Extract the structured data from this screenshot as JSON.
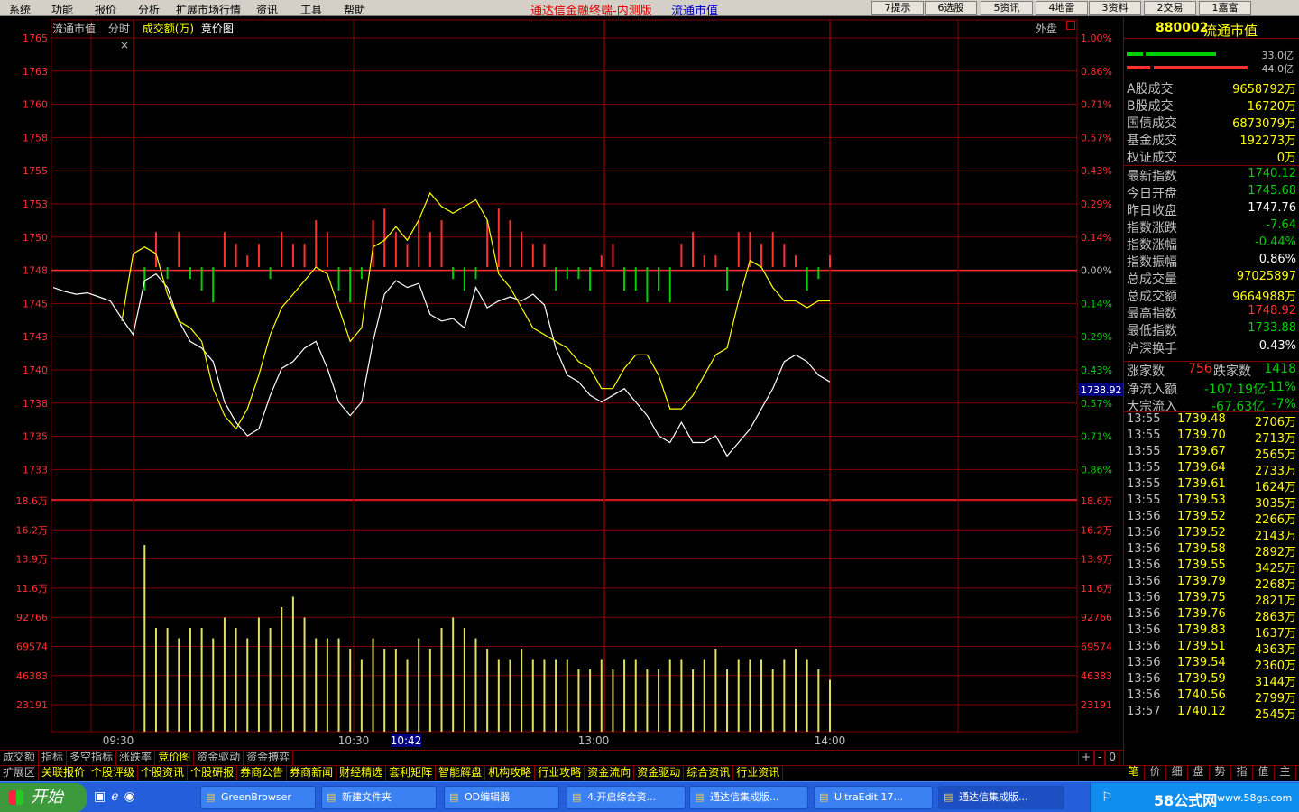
{
  "menu": [
    "系统",
    "功能",
    "报价",
    "分析",
    "扩展市场行情",
    "资讯",
    "工具",
    "帮助"
  ],
  "app_title": "通达信金融终端-内测版",
  "app_subtitle": "流通市值",
  "toolbar_buttons": [
    "7提示",
    "6选股",
    "5资讯",
    "4地雷",
    "3资料",
    "2交易",
    "1嘉富"
  ],
  "chart_header": {
    "name": "流通市值",
    "mode": "分时",
    "indicator": "成交额(万)",
    "extra": "竞价图",
    "outer": "外盘"
  },
  "colors": {
    "up": "#ff3030",
    "down": "#00d000",
    "price": "#ffffff",
    "avg": "#ffff00",
    "grid": "#800000",
    "volume": "#e0e060"
  },
  "chart_data": {
    "type": "line",
    "y_left_price": [
      "1765",
      "1763",
      "1760",
      "1758",
      "1755",
      "1753",
      "1750",
      "1748",
      "1745",
      "1743",
      "1740",
      "1738",
      "1735",
      "1733"
    ],
    "y_right_pct": [
      "1.00%",
      "0.86%",
      "0.71%",
      "0.57%",
      "0.43%",
      "0.29%",
      "0.14%",
      "0.00%",
      "0.14%",
      "0.29%",
      "0.43%",
      "0.57%",
      "0.71%",
      "0.86%"
    ],
    "y_left_volume": [
      "18.6万",
      "16.2万",
      "13.9万",
      "11.6万",
      "92766",
      "69574",
      "46383",
      "23191"
    ],
    "x_ticks": [
      "09:30",
      "10:30",
      "13:00",
      "14:00"
    ],
    "x_cursor": "10:42",
    "price_cursor": "1738.92",
    "price_range": [
      1732,
      1766
    ],
    "price_series": [
      1746.5,
      1746.2,
      1746.0,
      1746.1,
      1745.8,
      1745.5,
      1744.2,
      1743.0,
      1747.0,
      1747.5,
      1746.5,
      1744.0,
      1742.5,
      1742.0,
      1741.0,
      1738.0,
      1736.5,
      1735.5,
      1736.0,
      1738.5,
      1740.5,
      1741.0,
      1742.0,
      1742.5,
      1740.5,
      1738.0,
      1737.0,
      1738.0,
      1742.5,
      1746.0,
      1747.0,
      1746.5,
      1746.8,
      1744.5,
      1744.0,
      1744.2,
      1743.5,
      1746.5,
      1745.0,
      1745.5,
      1745.8,
      1745.5,
      1746.0,
      1745.2,
      1742.0,
      1740.0,
      1739.5,
      1738.5,
      1738.0,
      1738.5,
      1739.0,
      1738.0,
      1737.0,
      1735.5,
      1735.0,
      1736.5,
      1735.0,
      1735.0,
      1735.5,
      1734.0,
      1735.0,
      1736.0,
      1737.5,
      1739.0,
      1741.0,
      1741.5,
      1741.0,
      1740.0,
      1739.5
    ],
    "avg_series": [
      null,
      null,
      null,
      null,
      null,
      null,
      1744.0,
      1749.0,
      1749.5,
      1749.0,
      1746.0,
      1744.0,
      1743.5,
      1742.5,
      1739.0,
      1737.0,
      1736.0,
      1737.5,
      1740.0,
      1743.0,
      1745.0,
      1746.0,
      1747.0,
      1748.0,
      1747.5,
      1745.0,
      1742.5,
      1743.5,
      1749.5,
      1750.0,
      1751.0,
      1750.0,
      1751.5,
      1753.5,
      1752.5,
      1752.0,
      1752.5,
      1753.0,
      1751.5,
      1747.5,
      1746.5,
      1745.0,
      1743.5,
      1743.0,
      1742.5,
      1742.0,
      1741.0,
      1740.5,
      1739.0,
      1739.0,
      1740.5,
      1741.5,
      1741.5,
      1740.0,
      1737.5,
      1737.5,
      1738.5,
      1740.0,
      1741.5,
      1742.0,
      1745.5,
      1748.5,
      1748.0,
      1746.5,
      1745.5,
      1745.5,
      1745.0,
      1745.5,
      1745.5
    ],
    "change_bars": [
      0,
      0,
      0,
      0,
      0,
      0,
      0,
      0,
      -2,
      3,
      -1,
      3,
      -1,
      -2,
      -3,
      3,
      2,
      1,
      2,
      -1,
      3,
      2,
      2,
      4,
      3,
      -2,
      -3,
      -1,
      4,
      5,
      3,
      2,
      4,
      3,
      4,
      -1,
      -2,
      -1,
      4,
      5,
      4,
      3,
      2,
      2,
      -2,
      -1,
      -1,
      -2,
      1,
      2,
      -2,
      -2,
      -3,
      -2,
      -3,
      2,
      3,
      1,
      1,
      -2,
      3,
      3,
      2,
      3,
      2,
      1,
      -2,
      -1,
      1
    ],
    "volume": [
      0,
      0,
      0,
      0,
      0,
      0,
      0,
      0,
      18,
      10,
      10,
      9,
      10,
      10,
      9,
      11,
      10,
      9,
      11,
      10,
      12,
      13,
      11,
      9,
      9,
      9,
      8,
      7,
      9,
      8,
      8,
      7,
      9,
      8,
      10,
      11,
      10,
      9,
      8,
      7,
      7,
      8,
      7,
      7,
      7,
      7,
      6,
      6,
      7,
      6,
      7,
      7,
      6,
      6,
      7,
      7,
      6,
      7,
      8,
      6,
      7,
      7,
      7,
      6,
      7,
      8,
      7,
      6,
      5
    ]
  },
  "sidebar": {
    "code": "880002",
    "name": "流通市值",
    "bar_values": [
      "33.0亿",
      "44.0亿"
    ],
    "stats": [
      {
        "label": "A股成交",
        "value": "9658792万",
        "color": "#ffff00"
      },
      {
        "label": "B股成交",
        "value": "16720万",
        "color": "#ffff00"
      },
      {
        "label": "国债成交",
        "value": "6873079万",
        "color": "#ffff00"
      },
      {
        "label": "基金成交",
        "value": "192273万",
        "color": "#ffff00"
      },
      {
        "label": "权证成交",
        "value": "0万",
        "color": "#ffff00"
      },
      {
        "label": "最新指数",
        "value": "1740.12",
        "color": "#00d000"
      },
      {
        "label": "今日开盘",
        "value": "1745.68",
        "color": "#00d000"
      },
      {
        "label": "昨日收盘",
        "value": "1747.76",
        "color": "#ffffff"
      },
      {
        "label": "指数涨跌",
        "value": "-7.64",
        "color": "#00d000"
      },
      {
        "label": "指数涨幅",
        "value": "-0.44%",
        "color": "#00d000"
      },
      {
        "label": "指数振幅",
        "value": "0.86%",
        "color": "#ffffff"
      },
      {
        "label": "总成交量",
        "value": "97025897",
        "color": "#ffff00"
      },
      {
        "label": "总成交额",
        "value": "9664988万",
        "color": "#ffff00"
      },
      {
        "label": "最高指数",
        "value": "1748.92",
        "color": "#ff3030"
      },
      {
        "label": "最低指数",
        "value": "1733.88",
        "color": "#00d000"
      },
      {
        "label": "沪深换手",
        "value": "0.43%",
        "color": "#ffffff"
      }
    ],
    "up_label": "涨家数",
    "up_count": "756",
    "down_label": "跌家数",
    "down_count": "1418",
    "net_inflow_label": "净流入额",
    "net_inflow": "-107.19亿",
    "net_inflow_pct": "-11%",
    "block_inflow_label": "大宗流入",
    "block_inflow": "-67.63亿",
    "block_inflow_pct": "-7%",
    "ticks": [
      {
        "time": "13:55",
        "price": "1739.48",
        "vol": "2706万"
      },
      {
        "time": "13:55",
        "price": "1739.70",
        "vol": "2713万"
      },
      {
        "time": "13:55",
        "price": "1739.67",
        "vol": "2565万"
      },
      {
        "time": "13:55",
        "price": "1739.64",
        "vol": "2733万"
      },
      {
        "time": "13:55",
        "price": "1739.61",
        "vol": "1624万"
      },
      {
        "time": "13:55",
        "price": "1739.53",
        "vol": "3035万"
      },
      {
        "time": "13:56",
        "price": "1739.52",
        "vol": "2266万"
      },
      {
        "time": "13:56",
        "price": "1739.52",
        "vol": "2143万"
      },
      {
        "time": "13:56",
        "price": "1739.58",
        "vol": "2892万"
      },
      {
        "time": "13:56",
        "price": "1739.55",
        "vol": "3425万"
      },
      {
        "time": "13:56",
        "price": "1739.79",
        "vol": "2268万"
      },
      {
        "time": "13:56",
        "price": "1739.75",
        "vol": "2821万"
      },
      {
        "time": "13:56",
        "price": "1739.76",
        "vol": "2863万"
      },
      {
        "time": "13:56",
        "price": "1739.83",
        "vol": "1637万"
      },
      {
        "time": "13:56",
        "price": "1739.51",
        "vol": "4363万"
      },
      {
        "time": "13:56",
        "price": "1739.54",
        "vol": "2360万"
      },
      {
        "time": "13:56",
        "price": "1739.59",
        "vol": "3144万"
      },
      {
        "time": "13:56",
        "price": "1740.56",
        "vol": "2799万"
      },
      {
        "time": "13:57",
        "price": "1740.12",
        "vol": "2545万"
      }
    ]
  },
  "bottom_tabs_1": [
    "成交额",
    "指标",
    "多空指标",
    "涨跌率",
    "竞价图",
    "资金驱动",
    "资金搏弈"
  ],
  "bottom_tabs_1_active": "竞价图",
  "bottom_tabs_1_ctrl": [
    "+",
    "-",
    "0"
  ],
  "bottom_tabs_2": [
    "扩展区",
    "关联报价",
    "个股评级",
    "个股资讯",
    "个股研报",
    "券商公告",
    "券商新闻",
    "财经精选",
    "套利矩阵",
    "智能解盘",
    "机构攻略",
    "行业攻略",
    "资金流向",
    "资金驱动",
    "综合资讯",
    "行业资讯"
  ],
  "side_tabs": [
    "笔",
    "价",
    "细",
    "盘",
    "势",
    "指",
    "值",
    "主"
  ],
  "taskbar": {
    "start": "开始",
    "tasks": [
      "GreenBrowser",
      "新建文件夹",
      "OD编辑器",
      "4.开启综合资...",
      "通达信集成版...",
      "UltraEdit 17...",
      "通达信集成版..."
    ],
    "tray_logo": "58公式网",
    "tray_url": "www.58gs.com"
  }
}
